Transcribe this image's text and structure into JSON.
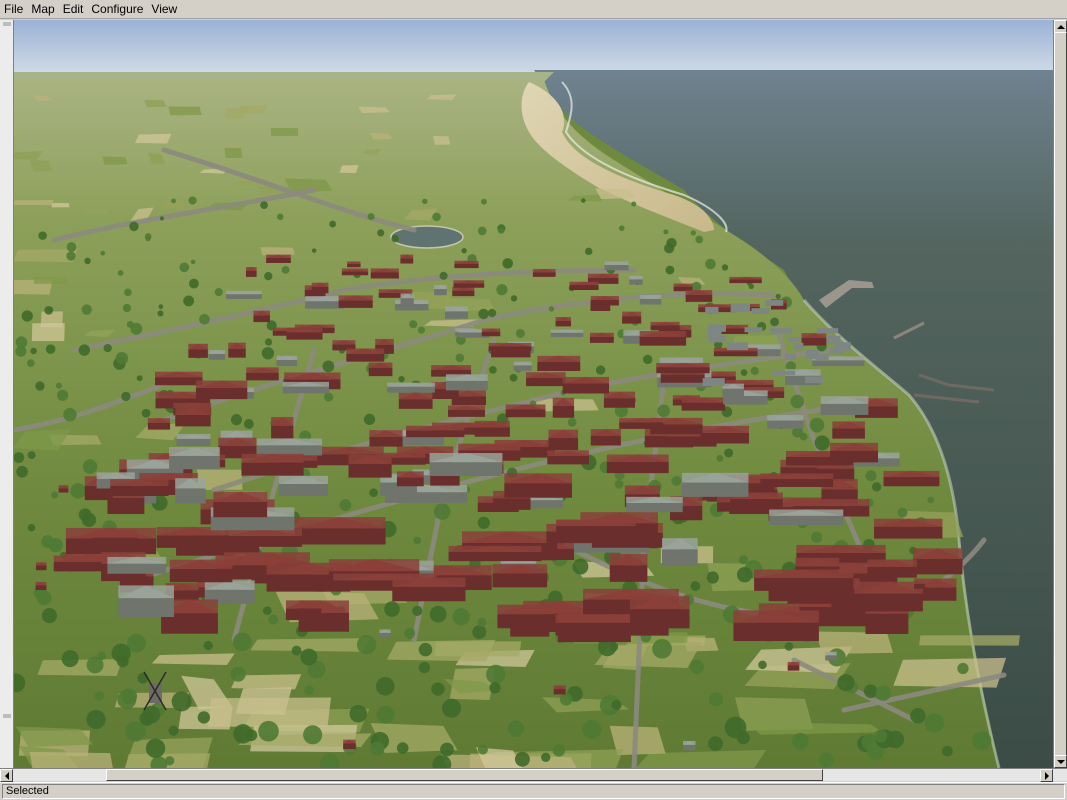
{
  "menu": {
    "items": [
      {
        "label": "File"
      },
      {
        "label": "Map"
      },
      {
        "label": "Edit"
      },
      {
        "label": "Configure"
      },
      {
        "label": "View"
      }
    ]
  },
  "viewport": {
    "content": "3d-terrain-render",
    "colors": {
      "sky_top": "#9ab2d6",
      "sky_horizon": "#c9d6e4",
      "sea": "#4a5d55",
      "sea_deep": "#3c4e48",
      "beach": "#d6c9a0",
      "grass": "#7d9448",
      "field_light": "#b9b27a",
      "roof_red": "#8a3f3a",
      "roof_gray": "#9aa39a",
      "road": "#8c8a7e",
      "tree": "#3f6a2a"
    }
  },
  "status": {
    "text": "Selected"
  },
  "scrollbars": {
    "horizontal_position": 0.3,
    "vertical_position": 0
  }
}
